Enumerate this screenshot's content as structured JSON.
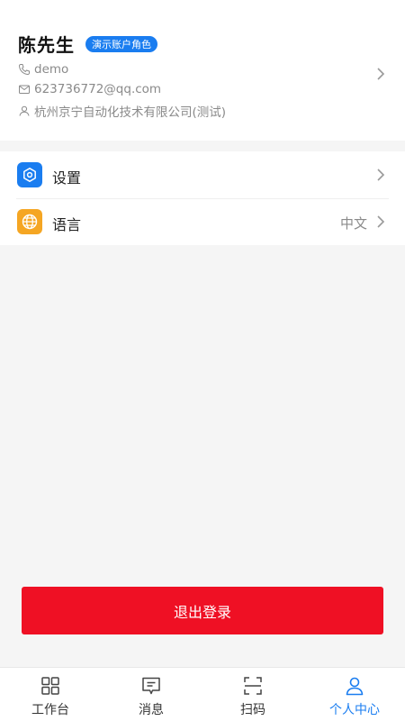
{
  "profile": {
    "name": "陈先生",
    "role_badge": "演示账户角色",
    "username": "demo",
    "email": "623736772@qq.com",
    "company": "杭州京宁自动化技术有限公司(测试)",
    "icons": {
      "username": "phone-icon",
      "email": "mail-icon",
      "company": "user-icon"
    }
  },
  "menu": {
    "items": [
      {
        "label": "设置",
        "icon": "gear-icon",
        "value": ""
      },
      {
        "label": "语言",
        "icon": "globe-icon",
        "value": "中文"
      }
    ]
  },
  "logout": {
    "label": "退出登录"
  },
  "tabbar": {
    "items": [
      {
        "label": "工作台",
        "icon": "grid-icon",
        "active": false
      },
      {
        "label": "消息",
        "icon": "message-icon",
        "active": false
      },
      {
        "label": "扫码",
        "icon": "scan-icon",
        "active": false
      },
      {
        "label": "个人中心",
        "icon": "person-icon",
        "active": true
      }
    ]
  },
  "colors": {
    "accent": "#1a7df0",
    "danger": "#ef1024",
    "language_icon": "#f5a623",
    "muted_text": "#8a8a8a"
  }
}
